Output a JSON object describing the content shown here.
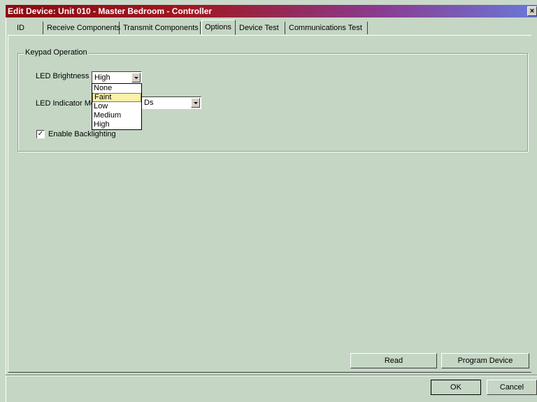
{
  "window": {
    "title": "Edit Device: Unit 010 - Master Bedroom - Controller",
    "close_glyph": "×"
  },
  "tabs": [
    {
      "label": "ID"
    },
    {
      "label": "Receive Components"
    },
    {
      "label": "Transmit Components"
    },
    {
      "label": "Options",
      "active": true
    },
    {
      "label": "Device Test"
    },
    {
      "label": "Communications Test"
    }
  ],
  "keypad": {
    "group_label": "Keypad Operation",
    "led_brightness_label": "LED Brightness",
    "led_brightness_value": "High",
    "led_brightness_options": [
      "None",
      "Faint",
      "Low",
      "Medium",
      "High"
    ],
    "led_brightness_highlighted": "Faint",
    "led_indicator_label": "LED Indicator Mo",
    "led_indicator_value": "Ds",
    "backlight_label": "Enable Backlighting",
    "backlight_checked": true,
    "check_glyph": "✓"
  },
  "buttons": {
    "read": "Read",
    "program": "Program Device",
    "ok": "OK",
    "cancel": "Cancel"
  }
}
